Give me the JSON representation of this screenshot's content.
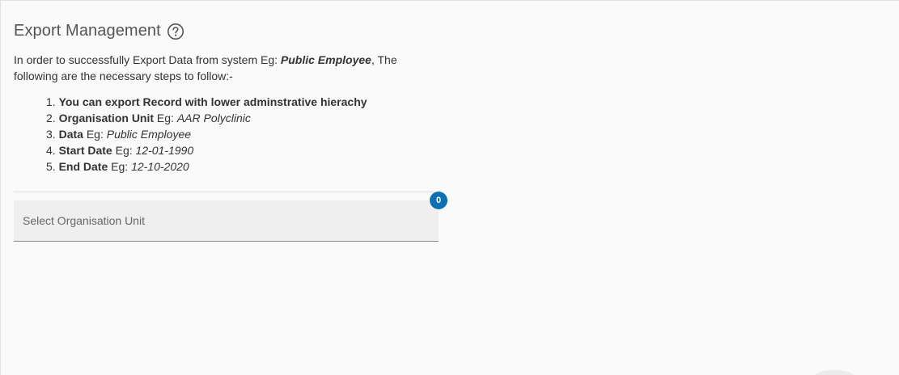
{
  "header": {
    "title": "Export Management",
    "help_icon": "question-circle-icon"
  },
  "intro": {
    "text_before": "In order to successfully Export Data from system Eg: ",
    "example": "Public Employee",
    "text_after": ", The following are the necessary steps to follow:-"
  },
  "steps": [
    {
      "number": "1.",
      "label": "You can export Record with lower adminstrative hierachy",
      "eg": "",
      "value": ""
    },
    {
      "number": "2.",
      "label": "Organisation Unit",
      "eg": " Eg: ",
      "value": "AAR Polyclinic"
    },
    {
      "number": "3.",
      "label": "Data",
      "eg": " Eg: ",
      "value": "Public Employee"
    },
    {
      "number": "4.",
      "label": "Start Date",
      "eg": " Eg: ",
      "value": "12-01-1990"
    },
    {
      "number": "5.",
      "label": "End Date",
      "eg": " Eg: ",
      "value": "12-10-2020"
    }
  ],
  "org_unit_select": {
    "placeholder": "Select Organisation Unit",
    "selected_count": "0"
  },
  "colors": {
    "badge": "#0f6fb3",
    "field_background": "#efefef"
  }
}
